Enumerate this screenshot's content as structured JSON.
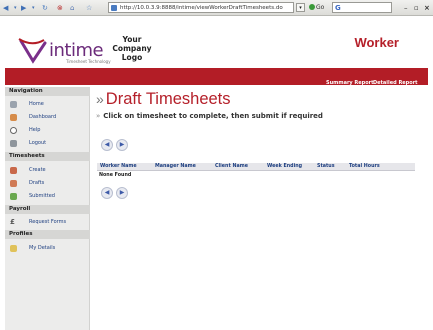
{
  "browser": {
    "back_icon": "back-arrow-icon",
    "forward_icon": "forward-arrow-icon",
    "url": "http://10.0.3.9:8888/intime/viewWorkerDraftTimesheets.do",
    "go_label": "Go",
    "accent": "#3f6fb5"
  },
  "header": {
    "brand": "intime",
    "brand_sub": "Timesheet Technology",
    "company_logo": [
      "Your",
      "Company",
      "Logo"
    ],
    "role": "Worker",
    "accent": "#b5202a"
  },
  "redbar": {
    "color": "#b31d26",
    "links": [
      "Summary Report",
      "Detailed Report"
    ]
  },
  "sidebar": {
    "sections": [
      {
        "title": "Navigation",
        "items": [
          {
            "label": "Home",
            "icon": "home-icon"
          },
          {
            "label": "Dashboard",
            "icon": "dashboard-icon"
          },
          {
            "label": "Help",
            "icon": "help-icon"
          },
          {
            "label": "Logout",
            "icon": "logout-icon"
          }
        ]
      },
      {
        "title": "Timesheets",
        "items": [
          {
            "label": "Create",
            "icon": "create-icon"
          },
          {
            "label": "Drafts",
            "icon": "drafts-icon"
          },
          {
            "label": "Submitted",
            "icon": "submitted-icon"
          }
        ]
      },
      {
        "title": "Payroll",
        "items": [
          {
            "label": "Request Forms",
            "icon": "pound-icon"
          }
        ]
      },
      {
        "title": "Profiles",
        "items": [
          {
            "label": "My Details",
            "icon": "details-icon"
          }
        ]
      }
    ]
  },
  "main": {
    "title": "Draft Timesheets",
    "instruction": "Click on timesheet to complete, then submit if required",
    "columns": [
      "Worker Name",
      "Manager Name",
      "Client Name",
      "Week Ending",
      "Status",
      "Total Hours"
    ],
    "empty_text": "None Found",
    "prev_icon": "prev-page-icon",
    "next_icon": "next-page-icon"
  }
}
